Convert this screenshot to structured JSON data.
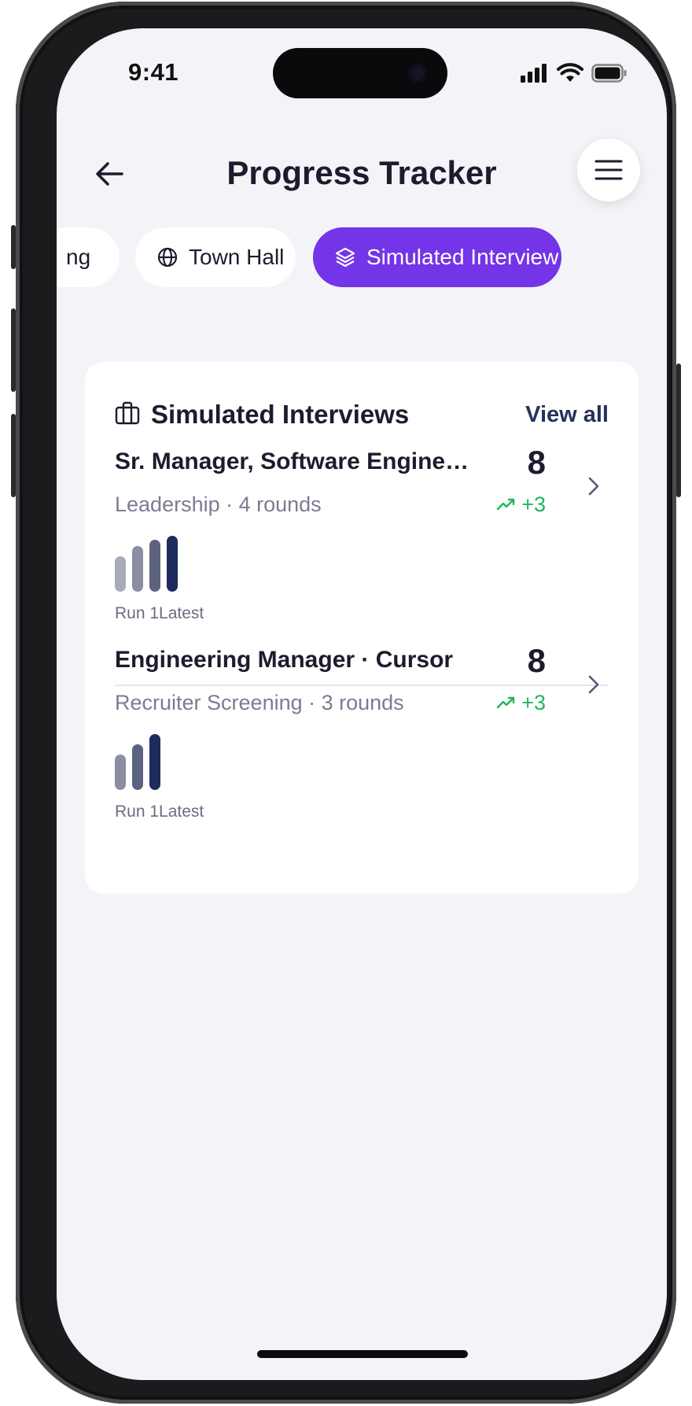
{
  "status_bar": {
    "time": "9:41"
  },
  "header": {
    "title": "Progress Tracker"
  },
  "chips": [
    {
      "label": "ng",
      "icon": "none",
      "active": false
    },
    {
      "label": "Town Hall",
      "icon": "globe-icon",
      "active": false
    },
    {
      "label": "Simulated Interview",
      "icon": "layers-icon",
      "active": true
    }
  ],
  "card": {
    "title": "Simulated Interviews",
    "view_all": "View all",
    "rows": [
      {
        "title": "Sr. Manager, Software Engine…",
        "subtitle": "Leadership · 4 rounds",
        "score": "8",
        "delta": "+3",
        "bar_caption": "Run 1Latest",
        "bar_levels": [
          0.62,
          0.8,
          0.92,
          0.98
        ]
      },
      {
        "title": "Engineering Manager · Cursor",
        "subtitle": "Recruiter Screening · 3 rounds",
        "score": "8",
        "delta": "+3",
        "bar_caption": "Run 1Latest",
        "bar_levels": [
          0.62,
          0.8,
          0.98
        ]
      }
    ]
  },
  "colors": {
    "accent": "#7434e7",
    "positive": "#22b55e",
    "bar_shades": [
      "#a9abbb",
      "#8a8ea3",
      "#5d627e",
      "#1f2b5c"
    ]
  }
}
